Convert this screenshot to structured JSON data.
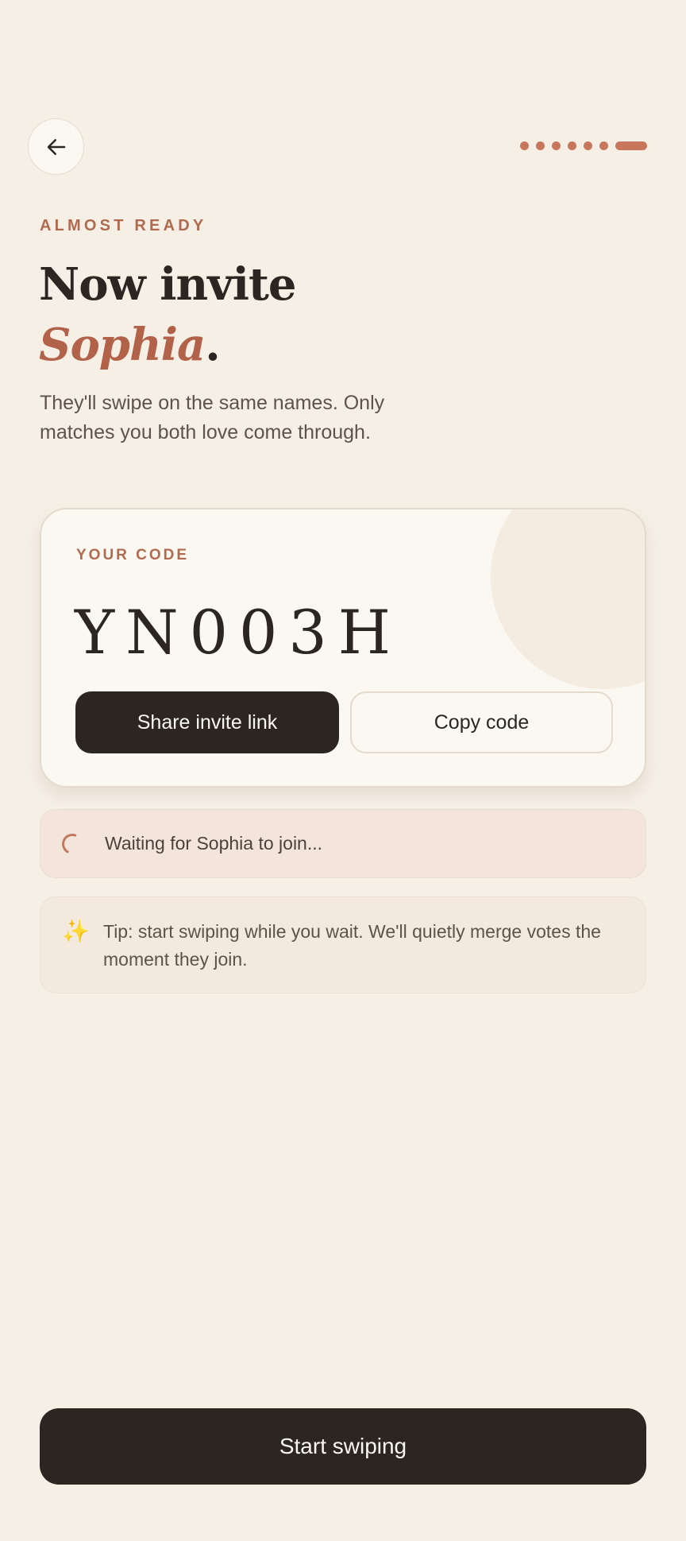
{
  "header": {
    "back_icon": "arrow-left-icon",
    "progress": {
      "total_steps": 7,
      "current_step": 7
    }
  },
  "intro": {
    "eyebrow": "ALMOST READY",
    "headline_prefix": "Now invite",
    "partner_name": "Sophia",
    "headline_suffix": ".",
    "subtitle": "They'll swipe on the same names. Only matches you both love come through."
  },
  "code_card": {
    "label": "YOUR CODE",
    "code": "YN003H",
    "share_label": "Share invite link",
    "copy_label": "Copy code"
  },
  "status": {
    "waiting_text": "Waiting for Sophia to join..."
  },
  "tip": {
    "icon": "sparkles-icon",
    "text": "Tip: start swiping while you wait. We'll quietly merge votes the moment they join."
  },
  "footer": {
    "start_label": "Start swiping"
  },
  "colors": {
    "background": "#f6efe6",
    "accent": "#c9775c",
    "primary_button": "#2b2622"
  }
}
